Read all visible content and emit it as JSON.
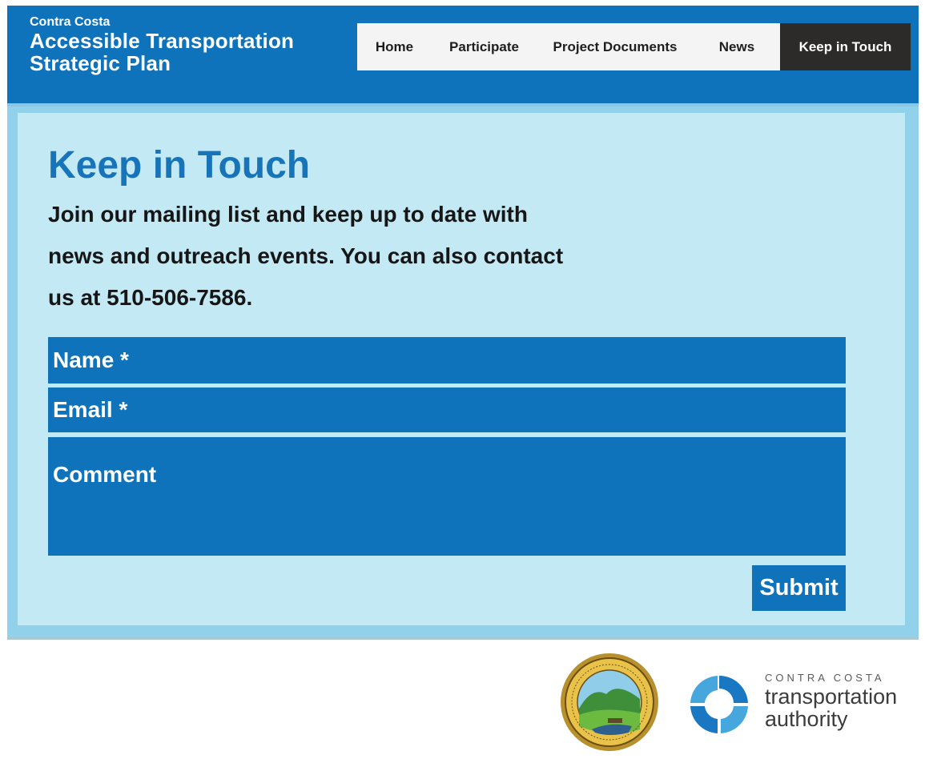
{
  "colors": {
    "header_blue": "#0f73bc",
    "panel_light": "#c3e9f5",
    "panel_border": "#91d2ea",
    "nav_active_bg": "#2d2a2a",
    "title_blue": "#1874b8"
  },
  "header": {
    "brand_line1": "Contra Costa",
    "brand_line2": "Accessible Transportation",
    "brand_line3": "Strategic Plan"
  },
  "nav": {
    "items": [
      {
        "label": "Home"
      },
      {
        "label": "Participate"
      },
      {
        "label": "Project Documents"
      },
      {
        "label": "News"
      },
      {
        "label": "Keep in Touch",
        "active": true
      }
    ]
  },
  "main": {
    "title": "Keep in Touch",
    "intro": "Join our mailing list and keep up to date with news and outreach events. You can also contact us at 510-506-7586."
  },
  "form": {
    "name_placeholder": "Name *",
    "email_placeholder": "Email *",
    "comment_placeholder": "Comment",
    "submit_label": "Submit"
  },
  "footer": {
    "seal_icon": "county-seal-icon",
    "authority_small": "CONTRA COSTA",
    "authority_line1": "transportation",
    "authority_line2": "authority"
  }
}
